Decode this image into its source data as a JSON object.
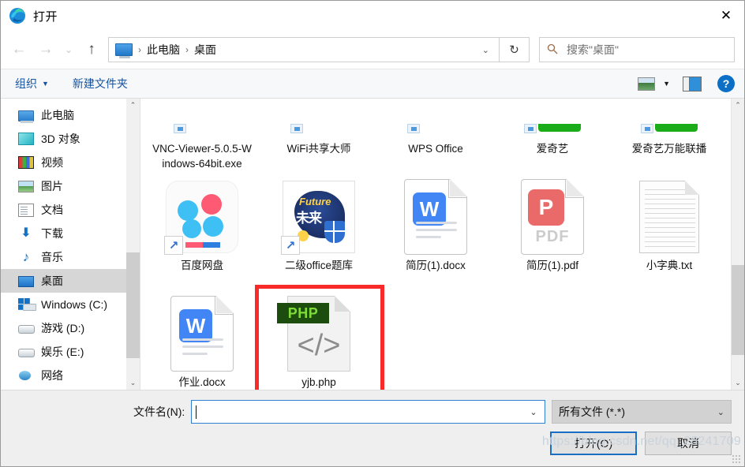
{
  "window": {
    "title": "打开",
    "app_icon": "edge-logo-icon",
    "close_label": "✕"
  },
  "nav": {
    "back_icon": "arrow-left-icon",
    "forward_icon": "arrow-right-icon",
    "recent_icon": "chevron-down-icon",
    "up_icon": "arrow-up-icon",
    "refresh_icon": "refresh-icon",
    "breadcrumb": {
      "root_icon": "this-pc-icon",
      "parts": [
        "此电脑",
        "桌面"
      ],
      "separator": "›",
      "dropdown_icon": "chevron-down-icon"
    },
    "search": {
      "icon": "search-icon",
      "placeholder": "搜索\"桌面\""
    }
  },
  "commandbar": {
    "organize_label": "组织",
    "organize_caret": "▼",
    "new_folder_label": "新建文件夹",
    "view_icon": "view-layout-icon",
    "view_caret": "▼",
    "preview_pane_icon": "preview-pane-icon",
    "help_icon": "?",
    "help_label": "帮助"
  },
  "sidebar": {
    "items": [
      {
        "label": "此电脑",
        "icon": "this-pc-icon",
        "selected": false,
        "indent": 0
      },
      {
        "label": "3D 对象",
        "icon": "3d-objects-icon",
        "selected": false,
        "indent": 1
      },
      {
        "label": "视频",
        "icon": "videos-icon",
        "selected": false,
        "indent": 1
      },
      {
        "label": "图片",
        "icon": "pictures-icon",
        "selected": false,
        "indent": 1
      },
      {
        "label": "文档",
        "icon": "documents-icon",
        "selected": false,
        "indent": 1
      },
      {
        "label": "下载",
        "icon": "downloads-icon",
        "selected": false,
        "indent": 1
      },
      {
        "label": "音乐",
        "icon": "music-icon",
        "selected": false,
        "indent": 1
      },
      {
        "label": "桌面",
        "icon": "desktop-icon",
        "selected": true,
        "indent": 1
      },
      {
        "label": "Windows (C:)",
        "icon": "windows-drive-icon",
        "selected": false,
        "indent": 1
      },
      {
        "label": "游戏 (D:)",
        "icon": "drive-icon",
        "selected": false,
        "indent": 1
      },
      {
        "label": "娱乐 (E:)",
        "icon": "drive-icon",
        "selected": false,
        "indent": 1
      },
      {
        "label": "网络",
        "icon": "network-icon",
        "selected": false,
        "indent": 0
      }
    ],
    "scrollbar": {
      "up_arrow": "⌃",
      "down_arrow": "⌄"
    }
  },
  "files": {
    "scrollbar": {
      "up_arrow": "⌃",
      "down_arrow": "⌄"
    },
    "items": [
      {
        "name": "VNC-Viewer-5.0.5-Windows-64bit.exe",
        "icon": "partial-app-icon",
        "row": 0
      },
      {
        "name": "WiFi共享大师",
        "icon": "partial-app-icon",
        "row": 0
      },
      {
        "name": "WPS Office",
        "icon": "partial-app-icon",
        "row": 0
      },
      {
        "name": "爱奇艺",
        "icon": "partial-green-icon",
        "row": 0
      },
      {
        "name": "爱奇艺万能联播",
        "icon": "partial-green-icon",
        "row": 0
      },
      {
        "name": "百度网盘",
        "icon": "baidu-netdisk-icon",
        "shortcut": true,
        "row": 1
      },
      {
        "name": "二级office题库",
        "icon": "office-exam-icon",
        "shortcut": true,
        "row": 1
      },
      {
        "name": "简历(1).docx",
        "icon": "wps-word-doc-icon",
        "shortcut": false,
        "row": 1
      },
      {
        "name": "简历(1).pdf",
        "icon": "pdf-doc-icon",
        "shortcut": false,
        "row": 1
      },
      {
        "name": "小字典.txt",
        "icon": "text-doc-icon",
        "shortcut": false,
        "row": 1
      },
      {
        "name": "作业.docx",
        "icon": "wps-word-doc-icon",
        "shortcut": false,
        "row": 2
      },
      {
        "name": "yjb.php",
        "icon": "php-file-icon",
        "shortcut": false,
        "row": 2,
        "highlighted": true
      }
    ],
    "highlight_color": "#f82a2a"
  },
  "footer": {
    "filename_label": "文件名(N):",
    "filename_value": "",
    "filename_dropdown_icon": "chevron-down-icon",
    "filter_value": "所有文件 (*.*)",
    "filter_dropdown_icon": "chevron-down-icon",
    "open_button": "打开(O)",
    "cancel_button": "取消",
    "watermark": "https://blog.csdn.net/qq_28241709"
  }
}
